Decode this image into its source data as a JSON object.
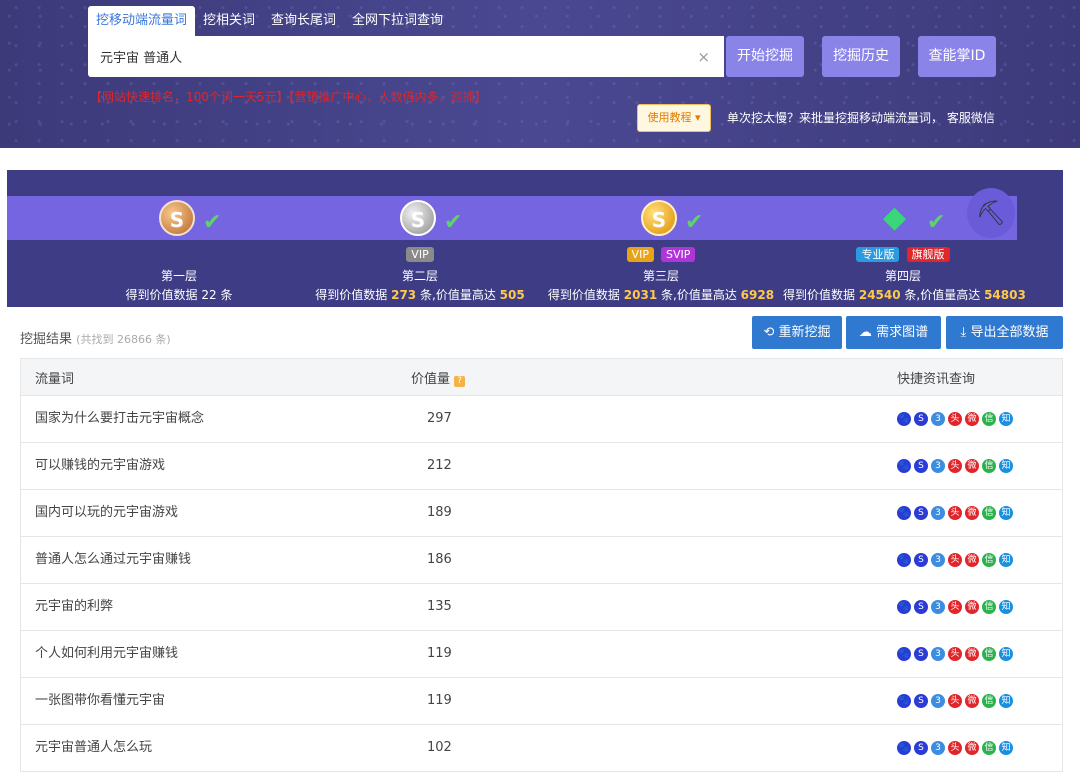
{
  "tabs": [
    "挖移动端流量词",
    "挖相关词",
    "查询长尾词",
    "全网下拉词查询"
  ],
  "search": {
    "value": "元宇宙 普通人",
    "clear": "×"
  },
  "buttons": {
    "start": "开始挖掘",
    "history": "挖掘历史",
    "id": "查能掌ID"
  },
  "promo": "【网站快速排名，100个词一天5元】【营销推广中心，人数倍内多，巡捕】",
  "tutorial": "使用教程",
  "tip": "单次挖太慢？来批量挖掘移动端流量词， 客服微信",
  "levels": [
    {
      "title": "第一层",
      "desc_prefix": "得到价值数据",
      "count": "22",
      "desc_suffix": "条",
      "value": "",
      "badges": []
    },
    {
      "title": "第二层",
      "desc_prefix": "得到价值数据",
      "count": "273",
      "desc_suffix": "条,价值量高达",
      "value": "505",
      "badges": [
        "VIP"
      ]
    },
    {
      "title": "第三层",
      "desc_prefix": "得到价值数据",
      "count": "2031",
      "desc_suffix": "条,价值量高达",
      "value": "6928",
      "badges": [
        "VIP",
        "SVIP"
      ]
    },
    {
      "title": "第四层",
      "desc_prefix": "得到价值数据",
      "count": "24540",
      "desc_suffix": "条,价值量高达",
      "value": "54803",
      "badges": [
        "专业版",
        "旗舰版"
      ]
    }
  ],
  "results": {
    "label": "挖掘结果",
    "count_note": "(共找到 26866 条)"
  },
  "actions": {
    "redo": "重新挖掘",
    "chart": "需求图谱",
    "export": "导出全部数据"
  },
  "table": {
    "headers": {
      "keyword": "流量词",
      "value": "价值量",
      "quick": "快捷资讯查询"
    },
    "rows": [
      {
        "keyword": "国家为什么要打击元宇宙概念",
        "value": "297"
      },
      {
        "keyword": "可以赚钱的元宇宙游戏",
        "value": "212"
      },
      {
        "keyword": "国内可以玩的元宇宙游戏",
        "value": "189"
      },
      {
        "keyword": "普通人怎么通过元宇宙赚钱",
        "value": "186"
      },
      {
        "keyword": "元宇宙的利弊",
        "value": "135"
      },
      {
        "keyword": "个人如何利用元宇宙赚钱",
        "value": "119"
      },
      {
        "keyword": "一张图带你看懂元宇宙",
        "value": "119"
      },
      {
        "keyword": "元宇宙普通人怎么玩",
        "value": "102"
      }
    ]
  },
  "quick_icons": [
    {
      "name": "baidu-icon",
      "color": "#2b3bd6",
      "glyph": "🐾"
    },
    {
      "name": "sogou-icon",
      "color": "#2b3bd6",
      "glyph": "S"
    },
    {
      "name": "360-icon",
      "color": "#3c8de0",
      "glyph": "3"
    },
    {
      "name": "toutiao-icon",
      "color": "#e0262a",
      "glyph": "头"
    },
    {
      "name": "weibo-icon",
      "color": "#e0262a",
      "glyph": "微"
    },
    {
      "name": "wechat-icon",
      "color": "#2bb24c",
      "glyph": "信"
    },
    {
      "name": "zhihu-icon",
      "color": "#1a8fe0",
      "glyph": "知"
    }
  ]
}
